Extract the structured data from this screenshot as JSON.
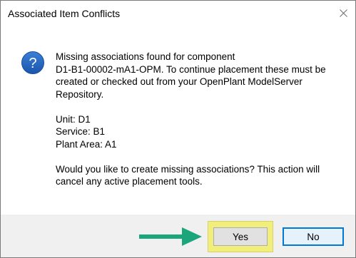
{
  "dialog": {
    "title": "Associated Item Conflicts",
    "close_icon": "close-icon",
    "info_icon": "question-icon",
    "icon_glyph": "?",
    "message": {
      "line1": "Missing associations found for component",
      "line2": "D1-B1-00002-mA1-OPM. To continue placement these must be",
      "line3": "created or checked out from your OpenPlant ModelServer",
      "line4": "Repository.",
      "unit": "Unit: D1",
      "service": "Service: B1",
      "plant_area": "Plant Area: A1",
      "question_line1": "Would you like to create missing associations? This action will",
      "question_line2": "cancel any active placement tools."
    },
    "buttons": {
      "yes": "Yes",
      "no": "No"
    }
  },
  "colors": {
    "icon_blue": "#1f5fbf",
    "highlight": "#f2ee7c",
    "arrow_green": "#1aa57a",
    "focus_border": "#0078d7",
    "footer_bg": "#f0f0f0"
  }
}
